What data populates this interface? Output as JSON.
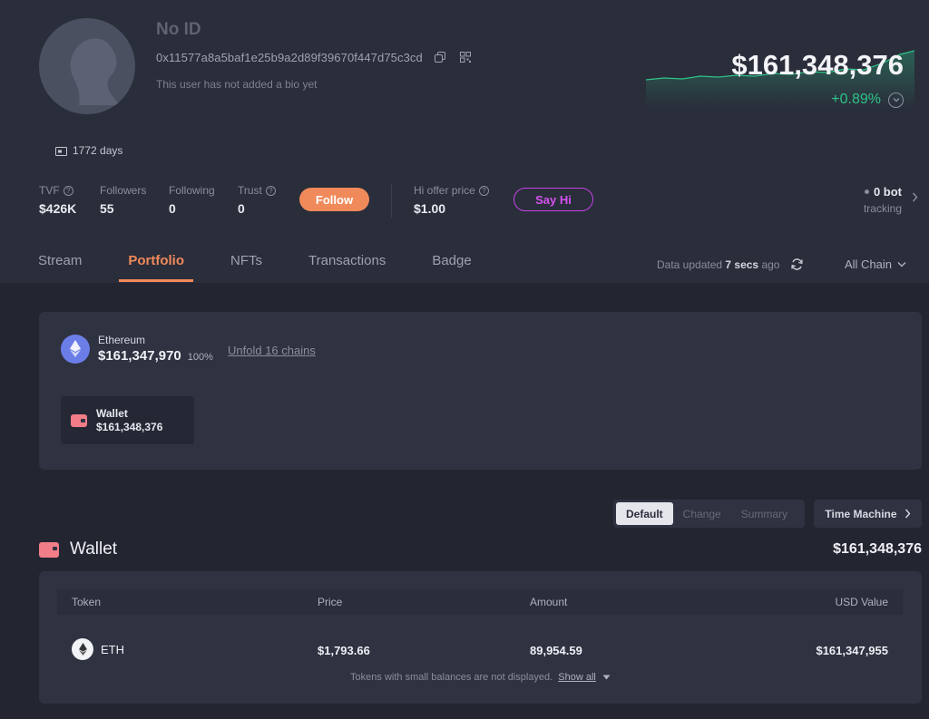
{
  "profile": {
    "username": "No ID",
    "address": "0x11577a8a5baf1e25b9a2d89f39670f447d75c3cd",
    "bio": "This user has not added a bio yet",
    "net_worth": "$161,348,376",
    "change": "+0.89%",
    "days": "1772 days"
  },
  "stats": {
    "tvf_label": "TVF",
    "tvf_value": "$426K",
    "followers_label": "Followers",
    "followers_value": "55",
    "following_label": "Following",
    "following_value": "0",
    "trust_label": "Trust",
    "trust_value": "0",
    "follow_button": "Follow",
    "hi_offer_label": "Hi offer price",
    "hi_offer_value": "$1.00",
    "say_hi_button": "Say Hi",
    "bot_count": "0 bot",
    "bot_tracking": "tracking"
  },
  "tabs": [
    {
      "label": "Stream"
    },
    {
      "label": "Portfolio"
    },
    {
      "label": "NFTs"
    },
    {
      "label": "Transactions"
    },
    {
      "label": "Badge"
    }
  ],
  "toolbar": {
    "updated_prefix": "Data updated",
    "updated_time": "7 secs",
    "updated_suffix": "ago",
    "chain_filter": "All Chain"
  },
  "summary": {
    "chain_name": "Ethereum",
    "chain_value": "$161,347,970",
    "chain_pct": "100%",
    "unfold_link": "Unfold 16 chains",
    "wallet_label": "Wallet",
    "wallet_value": "$161,348,376"
  },
  "view_options": [
    "Default",
    "Change",
    "Summary"
  ],
  "time_machine": "Time Machine",
  "wallet_section": {
    "title": "Wallet",
    "total": "$161,348,376",
    "columns": [
      "Token",
      "Price",
      "Amount",
      "USD Value"
    ],
    "rows": [
      {
        "token": "ETH",
        "price": "$1,793.66",
        "amount": "89,954.59",
        "usd_value": "$161,347,955"
      }
    ],
    "footnote": "Tokens with small balances are not displayed.",
    "show_all": "Show all"
  },
  "colors": {
    "accent": "#f08a5b",
    "positive": "#2ec388",
    "say_hi": "#d453f0",
    "wallet": "#f07d88",
    "ethereum": "#6b7ee8"
  }
}
